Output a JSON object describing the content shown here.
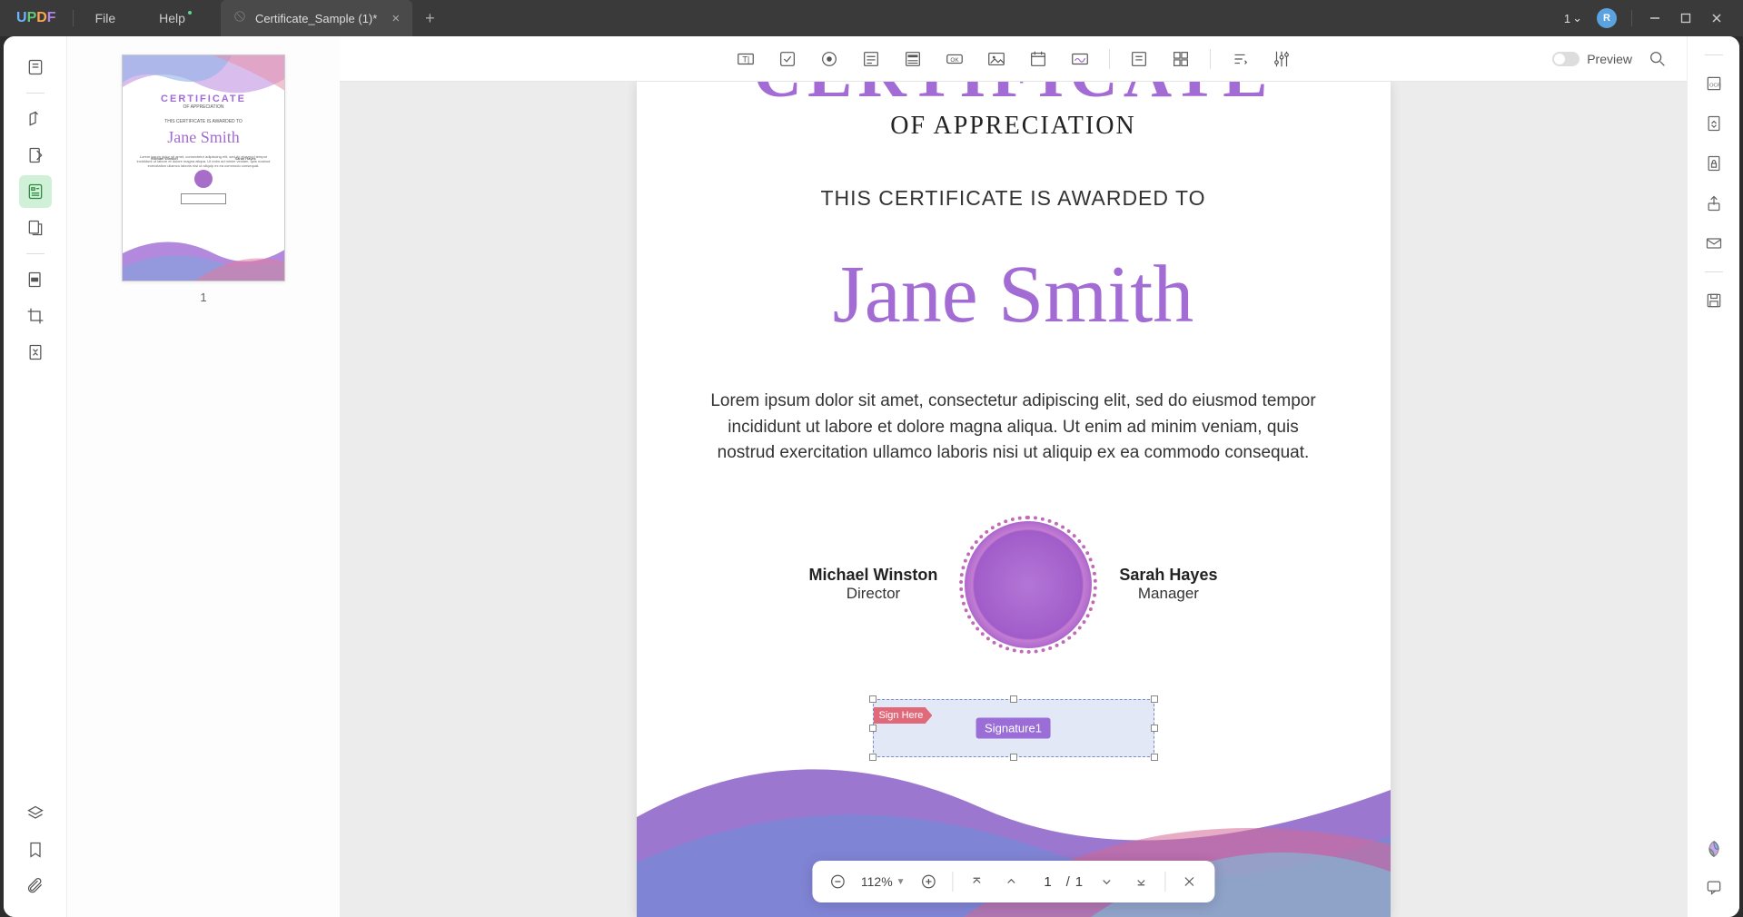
{
  "app": {
    "logo_letters": [
      "U",
      "P",
      "D",
      "F"
    ],
    "menu_file": "File",
    "menu_help": "Help",
    "tab_title": "Certificate_Sample (1)*",
    "dropdown_count": "1",
    "avatar_initial": "R"
  },
  "thumbnail": {
    "page_number": "1"
  },
  "toolbar": {
    "preview_label": "Preview"
  },
  "document": {
    "title": "CERTIFICATE",
    "subtitle": "OF APPRECIATION",
    "awarded_to": "THIS CERTIFICATE IS AWARDED TO",
    "recipient": "Jane Smith",
    "body": "Lorem ipsum dolor sit amet, consectetur adipiscing elit, sed do eiusmod tempor incididunt ut labore et dolore magna aliqua. Ut enim ad minim veniam, quis nostrud exercitation ullamco laboris nisi ut aliquip ex ea commodo consequat.",
    "signers": [
      {
        "name": "Michael Winston",
        "role": "Director"
      },
      {
        "name": "Sarah Hayes",
        "role": "Manager"
      }
    ],
    "sign_here": "Sign Here",
    "signature_field": "Signature1"
  },
  "nav": {
    "zoom": "112%",
    "current_page": "1",
    "total_pages": "1",
    "page_sep": "/"
  },
  "colors": {
    "accent": "#a36cd4",
    "field_bg": "#e3e8f7",
    "sign_tag": "#e06a7a"
  }
}
